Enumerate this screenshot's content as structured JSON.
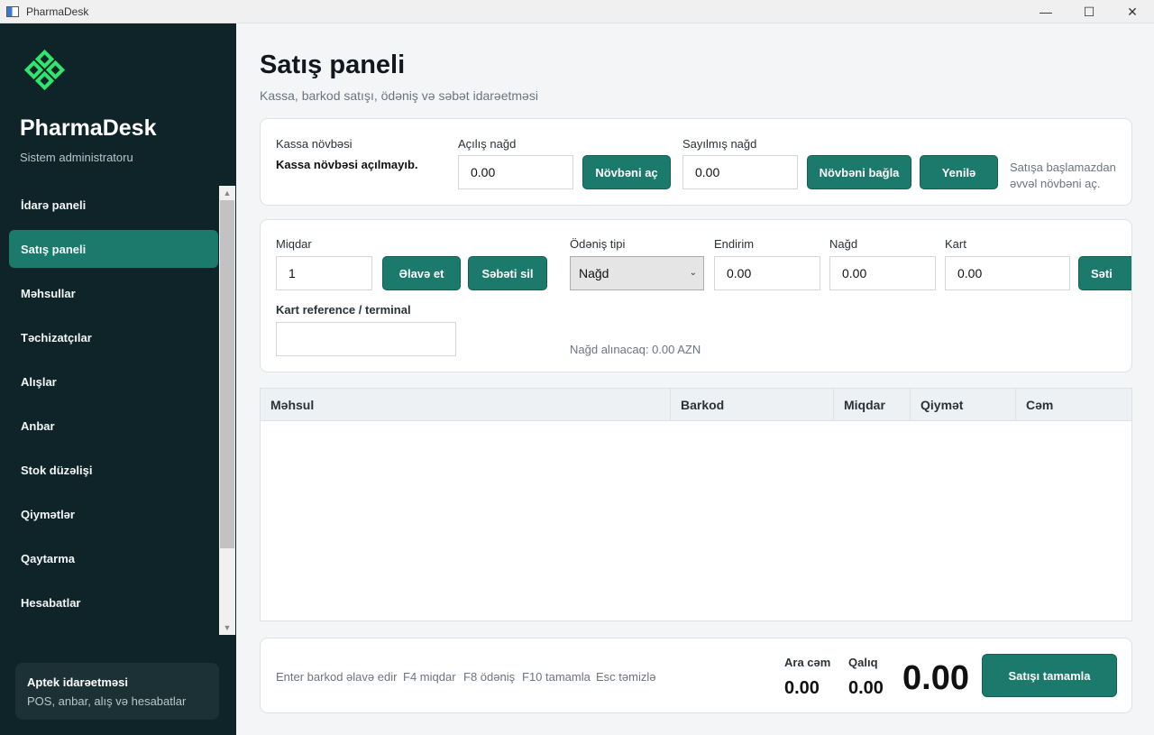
{
  "window": {
    "title": "PharmaDesk",
    "minimize": "—",
    "maximize": "☐",
    "close": "✕"
  },
  "sidebar": {
    "brand": "PharmaDesk",
    "role": "Sistem administratoru",
    "items": [
      {
        "label": "İdarə paneli"
      },
      {
        "label": "Satış paneli",
        "active": true
      },
      {
        "label": "Məhsullar"
      },
      {
        "label": "Təchizatçılar"
      },
      {
        "label": "Alışlar"
      },
      {
        "label": "Anbar"
      },
      {
        "label": "Stok düzəlişi"
      },
      {
        "label": "Qiymətlər"
      },
      {
        "label": "Qaytarma"
      },
      {
        "label": "Hesabatlar"
      }
    ],
    "card": {
      "title": "Aptek idarəetməsi",
      "subtitle": "POS, anbar, alış və hesabatlar"
    }
  },
  "header": {
    "title": "Satış paneli",
    "subtitle": "Kassa, barkod satışı, ödəniş və səbət idarəetməsi"
  },
  "shift": {
    "label": "Kassa növbəsi",
    "status": "Kassa növbəsi açılmayıb.",
    "opening_label": "Açılış nağd",
    "opening_value": "0.00",
    "open_button": "Növbəni aç",
    "counted_label": "Sayılmış nağd",
    "counted_value": "0.00",
    "close_button": "Növbəni bağla",
    "refresh_button": "Yenilə",
    "hint": "Satışa başlamazdan əvvəl növbəni aç."
  },
  "sale": {
    "qty_label": "Miqdar",
    "qty_value": "1",
    "add_button": "Əlavə et",
    "clear_button": "Səbəti sil",
    "payment_label": "Ödəniş tipi",
    "payment_value": "Nağd",
    "discount_label": "Endirim",
    "discount_value": "0.00",
    "cash_label": "Nağd",
    "cash_value": "0.00",
    "card_label": "Kart",
    "card_value": "0.00",
    "cut_button": "Səti",
    "ref_label": "Kart reference / terminal",
    "ref_value": "",
    "cash_due": "Nağd alınacaq: 0.00 AZN"
  },
  "table": {
    "columns": [
      "Məhsul",
      "Barkod",
      "Miqdar",
      "Qiymət",
      "Cəm"
    ],
    "rows": []
  },
  "footer": {
    "shortcuts": [
      "Enter barkod əlavə edir",
      "F4 miqdar",
      "F8 ödəniş",
      "F10 tamamla",
      "Esc təmizlə"
    ],
    "subtotal_label": "Ara cəm",
    "subtotal_value": "0.00",
    "remaining_label": "Qalıq",
    "remaining_value": "0.00",
    "total": "0.00",
    "complete_button": "Satışı tamamla"
  },
  "colors": {
    "sidebar": "#0f2428",
    "accent": "#1b7a6c",
    "logo": "#2ee66b"
  },
  "icons": {
    "app": "pharmadesk-app-icon",
    "logo": "pharmadesk-logo-icon",
    "select": "chevron-down-icon"
  }
}
